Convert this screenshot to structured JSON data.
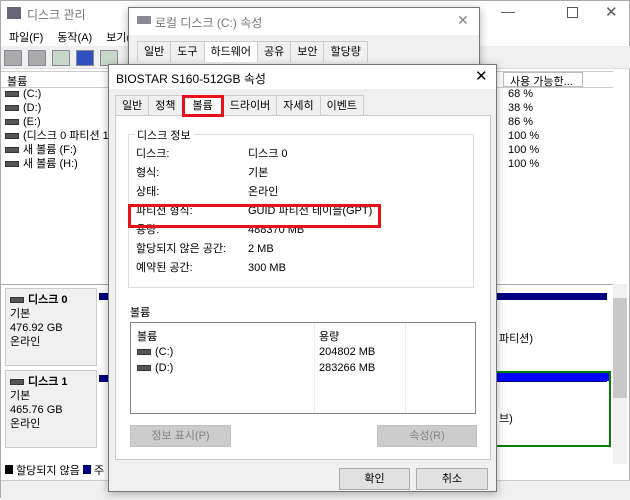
{
  "bg": {
    "title": "디스크 관리",
    "menu": [
      "파일(F)",
      "동작(A)",
      "보기(V)"
    ],
    "col_volume": "볼륨",
    "col_free": "사용 가능한...",
    "volumes": [
      {
        "name": "(C:)",
        "free": "68 %"
      },
      {
        "name": "(D:)",
        "free": "38 %"
      },
      {
        "name": "(E:)",
        "free": "86 %"
      },
      {
        "name": "(디스크 0 파티션 1)",
        "free": "100 %"
      },
      {
        "name": "새 볼륨 (F:)",
        "free": "100 %"
      },
      {
        "name": "새 볼륨 (H:)",
        "free": "100 %"
      }
    ],
    "disks": [
      {
        "name": "디스크 0",
        "type": "기본",
        "size": "476.92 GB",
        "status": "온라인",
        "partition_frag": "파티션)"
      },
      {
        "name": "디스크 1",
        "type": "기본",
        "size": "465.76 GB",
        "status": "온라인",
        "partition_frag": "브)"
      }
    ],
    "legend": [
      "할당되지 않음",
      "주"
    ]
  },
  "dlg2": {
    "title": "로컬 디스크 (C:) 속성",
    "tabs": [
      "일반",
      "도구",
      "하드웨어",
      "공유",
      "보안",
      "할당량"
    ]
  },
  "dlg": {
    "title": "BIOSTAR S160-512GB 속성",
    "tabs": [
      "일반",
      "정책",
      "볼륨",
      "드라이버",
      "자세히",
      "이벤트"
    ],
    "group": "디스크 정보",
    "info": [
      {
        "k": "디스크:",
        "v": "디스크 0"
      },
      {
        "k": "형식:",
        "v": "기본"
      },
      {
        "k": "상태:",
        "v": "온라인"
      },
      {
        "k": "파티션 형식:",
        "v": "GUID 파티션 테이블(GPT)"
      },
      {
        "k": "용량:",
        "v": "488370 MB"
      },
      {
        "k": "할당되지 않은 공간:",
        "v": "2 MB"
      },
      {
        "k": "예약된 공간:",
        "v": "300 MB"
      }
    ],
    "vol_label": "볼륨",
    "vol_col1": "볼륨",
    "vol_col2": "용량",
    "vols": [
      {
        "name": "(C:)",
        "size": "204802 MB"
      },
      {
        "name": "(D:)",
        "size": "283266 MB"
      }
    ],
    "btn_info": "정보 표시(P)",
    "btn_props": "속성(R)",
    "ok": "확인",
    "cancel": "취소"
  },
  "colors": {
    "highlight": "#e8101a",
    "primary": "#000080",
    "blue": "#0000ff",
    "green": "#008000"
  }
}
